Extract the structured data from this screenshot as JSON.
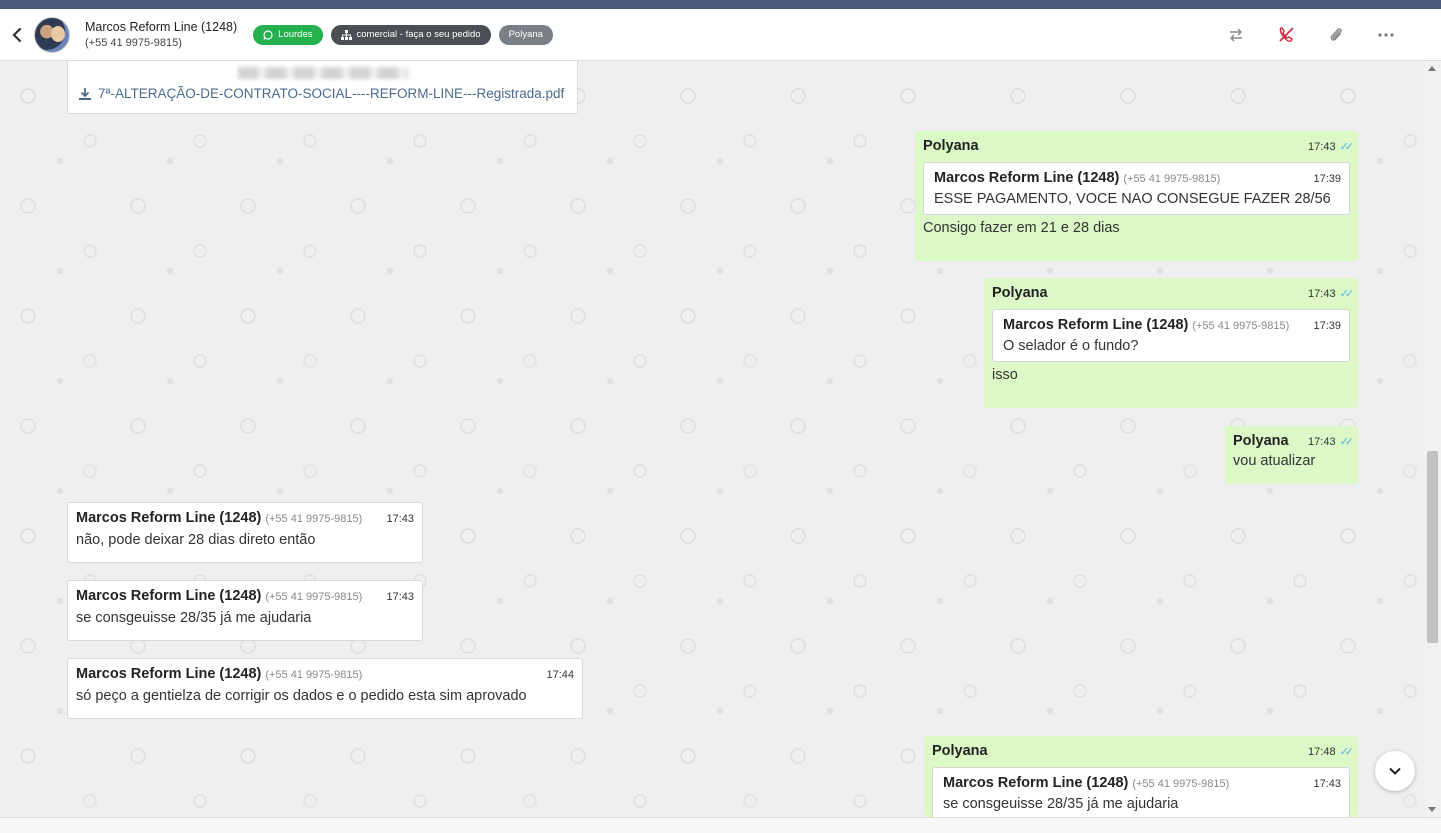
{
  "header": {
    "contact_name": "Marcos Reform Line (1248)",
    "contact_phone": "(+55 41 9975-9815)",
    "tags": [
      {
        "label": "Lourdes",
        "icon": "whatsapp-icon",
        "color": "#25b04e"
      },
      {
        "label": "comercial - faça o seu pedido",
        "icon": "org-chart-icon",
        "color": "#4b4f55"
      },
      {
        "label": "Polyana",
        "icon": "",
        "color": "#7a7f86"
      }
    ],
    "actions": [
      "transfer-icon",
      "end-call-icon",
      "attach-icon",
      "more-icon"
    ]
  },
  "file_card": {
    "filename": "7ª-ALTERAÇÃO-DE-CONTRATO-SOCIAL----REFORM-LINE---Registrada.pdf"
  },
  "messages": [
    {
      "sender": "Polyana",
      "time": "17:43",
      "status": "read",
      "quote": {
        "sender": "Marcos Reform Line (1248)",
        "phone": "(+55 41 9975-9815)",
        "time": "17:39",
        "text": "ESSE PAGAMENTO, VOCE NAO CONSEGUE FAZER 28/56"
      },
      "text": "Consigo fazer em 21 e 28 dias"
    },
    {
      "sender": "Polyana",
      "time": "17:43",
      "status": "read",
      "quote": {
        "sender": "Marcos Reform Line (1248)",
        "phone": "(+55 41 9975-9815)",
        "time": "17:39",
        "text": "O selador é o fundo?"
      },
      "text": "isso"
    },
    {
      "sender": "Polyana",
      "time": "17:43",
      "status": "read",
      "text": "vou atualizar"
    },
    {
      "sender": "Marcos Reform Line (1248)",
      "phone": "(+55 41 9975-9815)",
      "time": "17:43",
      "text": "não, pode deixar 28 dias direto então"
    },
    {
      "sender": "Marcos Reform Line (1248)",
      "phone": "(+55 41 9975-9815)",
      "time": "17:43",
      "text": "se consgeuisse 28/35 já me ajudaria"
    },
    {
      "sender": "Marcos Reform Line (1248)",
      "phone": "(+55 41 9975-9815)",
      "time": "17:44",
      "text": "só peço a gentielza de corrigir os dados e o pedido esta sim aprovado"
    },
    {
      "sender": "Polyana",
      "time": "17:48",
      "status": "read",
      "quote": {
        "sender": "Marcos Reform Line (1248)",
        "phone": "(+55 41 9975-9815)",
        "time": "17:43",
        "text": "se consgeuisse 28/35 já me ajudaria"
      }
    }
  ],
  "colors": {
    "outgoing_bubble": "#dcf8c6",
    "incoming_bubble": "#ffffff",
    "read_ticks": "#4fb6ec",
    "end_call": "#d0283a"
  }
}
